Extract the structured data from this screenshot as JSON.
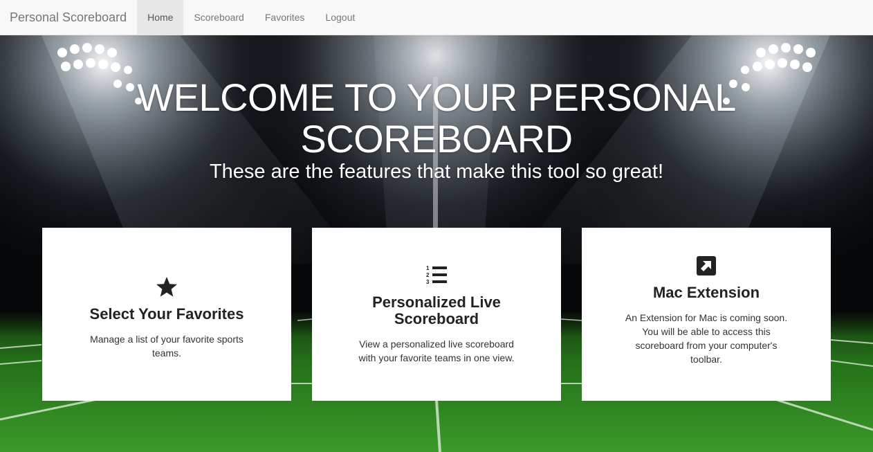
{
  "nav": {
    "brand": "Personal Scoreboard",
    "items": [
      {
        "label": "Home",
        "active": true
      },
      {
        "label": "Scoreboard",
        "active": false
      },
      {
        "label": "Favorites",
        "active": false
      },
      {
        "label": "Logout",
        "active": false
      }
    ]
  },
  "hero": {
    "title": "WELCOME TO YOUR PERSONAL SCOREBOARD",
    "subtitle": "These are the features that make this tool so great!"
  },
  "features": [
    {
      "icon": "star-icon",
      "title": "Select Your Favorites",
      "text": "Manage a list of your favorite sports teams."
    },
    {
      "icon": "ordered-list-icon",
      "title": "Personalized Live Scoreboard",
      "text": "View a personalized live scoreboard with your favorite teams in one view."
    },
    {
      "icon": "external-link-icon",
      "title": "Mac Extension",
      "text": "An Extension for Mac is coming soon. You will be able to access this scoreboard from your computer's toolbar."
    }
  ],
  "colors": {
    "navbar_bg": "#f8f8f8",
    "nav_active_bg": "#e7e7e7",
    "nav_text": "#777777",
    "field_green": "#2f8a1e",
    "card_bg": "#ffffff",
    "title_text": "#ffffff"
  }
}
